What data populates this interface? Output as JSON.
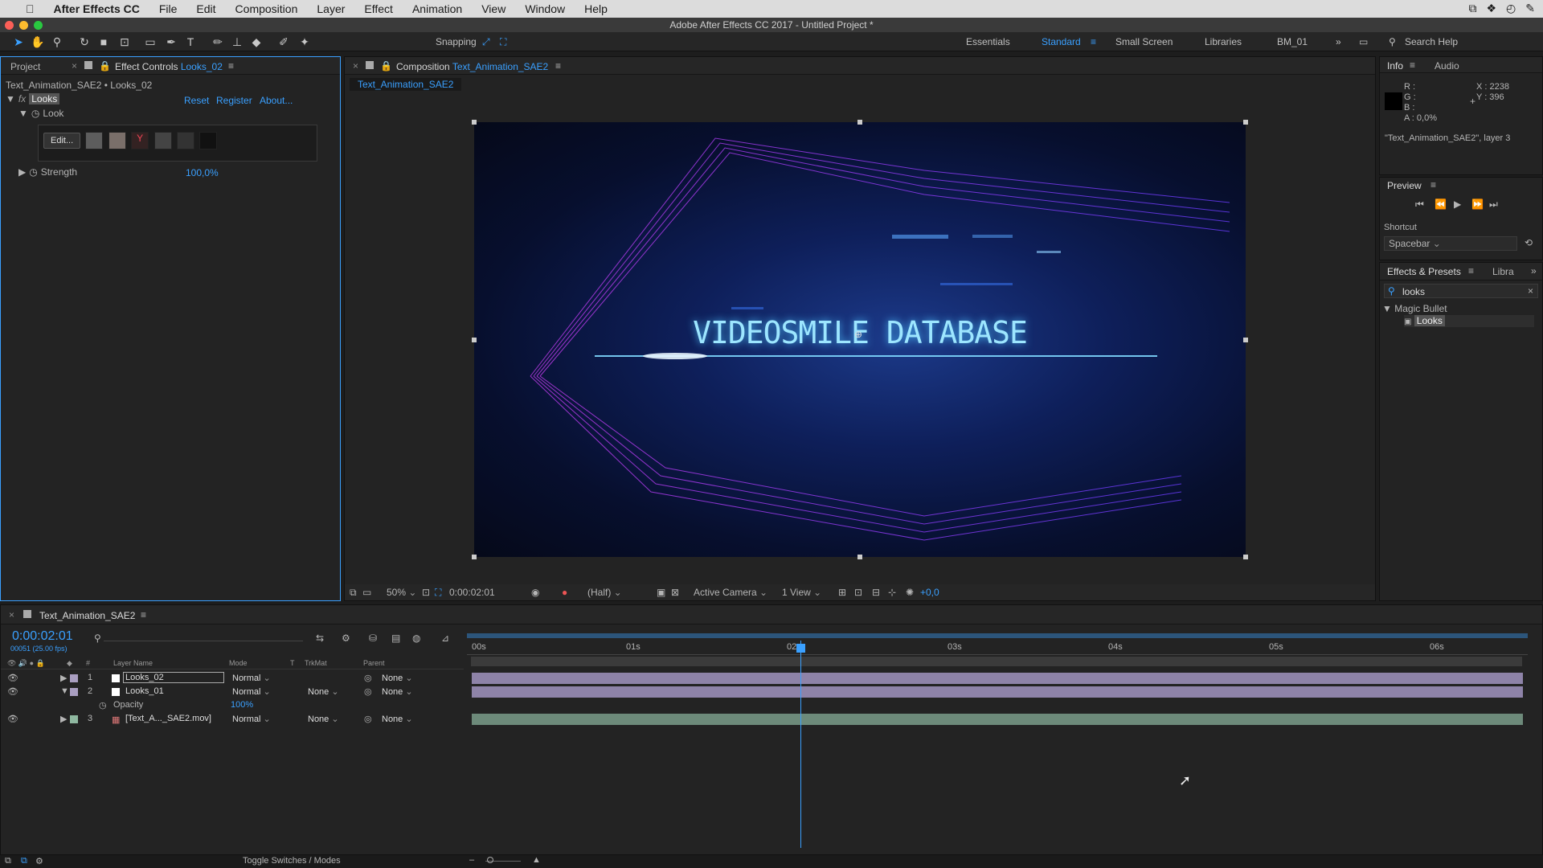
{
  "menubar": {
    "apple": "",
    "app_name": "After Effects CC",
    "items": [
      "File",
      "Edit",
      "Composition",
      "Layer",
      "Effect",
      "Animation",
      "View",
      "Window",
      "Help"
    ]
  },
  "window_title": "Adobe After Effects CC 2017 - Untitled Project *",
  "toolbar": {
    "snapping_label": "Snapping",
    "workspaces": [
      "Essentials",
      "Standard",
      "Small Screen",
      "Libraries",
      "BM_01"
    ],
    "active_workspace": "Standard",
    "search_help": "Search Help"
  },
  "left_panel": {
    "tab_project": "Project",
    "tab_effect_controls_prefix": "Effect Controls",
    "tab_effect_controls_layer": "Looks_02",
    "breadcrumb": "Text_Animation_SAE2 • Looks_02",
    "effect_name": "Looks",
    "reset": "Reset",
    "register": "Register",
    "about": "About...",
    "look_label": "Look",
    "edit_button": "Edit...",
    "strength_label": "Strength",
    "strength_value": "100,0%"
  },
  "composition": {
    "tab_prefix": "Composition",
    "tab_name": "Text_Animation_SAE2",
    "sub_tab": "Text_Animation_SAE2",
    "overlay_text": "VIDEOSMILE DATABASE",
    "zoom": "50%",
    "timecode": "0:00:02:01",
    "resolution": "(Half)",
    "camera": "Active Camera",
    "view": "1 View",
    "exposure": "+0,0"
  },
  "info_panel": {
    "tab_info": "Info",
    "tab_audio": "Audio",
    "r": "R :",
    "g": "G :",
    "b": "B :",
    "a": "A : 0,0%",
    "x": "X : 2238",
    "y": "Y : 396",
    "layer_info": "\"Text_Animation_SAE2\", layer 3"
  },
  "preview_panel": {
    "title": "Preview",
    "shortcut_label": "Shortcut",
    "shortcut_value": "Spacebar"
  },
  "effects_panel": {
    "tab_effects": "Effects & Presets",
    "tab_libra": "Libra",
    "search_value": "looks",
    "group": "Magic Bullet",
    "item": "Looks"
  },
  "timeline": {
    "tab_name": "Text_Animation_SAE2",
    "timecode": "0:00:02:01",
    "frames_fps": "00051 (25.00 fps)",
    "headers": {
      "num": "#",
      "layer_name": "Layer Name",
      "mode": "Mode",
      "t": "T",
      "trkmat": "TrkMat",
      "parent": "Parent"
    },
    "ruler": [
      "00s",
      "01s",
      "02s",
      "03s",
      "04s",
      "05s",
      "06s"
    ],
    "layers": [
      {
        "num": "1",
        "name": "Looks_02",
        "mode": "Normal",
        "trkmat": "",
        "parent": "None"
      },
      {
        "num": "2",
        "name": "Looks_01",
        "mode": "Normal",
        "trkmat": "None",
        "parent": "None"
      },
      {
        "num": "3",
        "name": "[Text_A..._SAE2.mov]",
        "mode": "Normal",
        "trkmat": "None",
        "parent": "None"
      }
    ],
    "opacity_label": "Opacity",
    "opacity_value": "100%",
    "toggle_label": "Toggle Switches / Modes"
  },
  "colors": {
    "accent": "#3aa0ff",
    "panel_bg": "#232323",
    "layer_bar_purple": "#8e83a8",
    "layer_bar_green": "#6d8a7a"
  }
}
